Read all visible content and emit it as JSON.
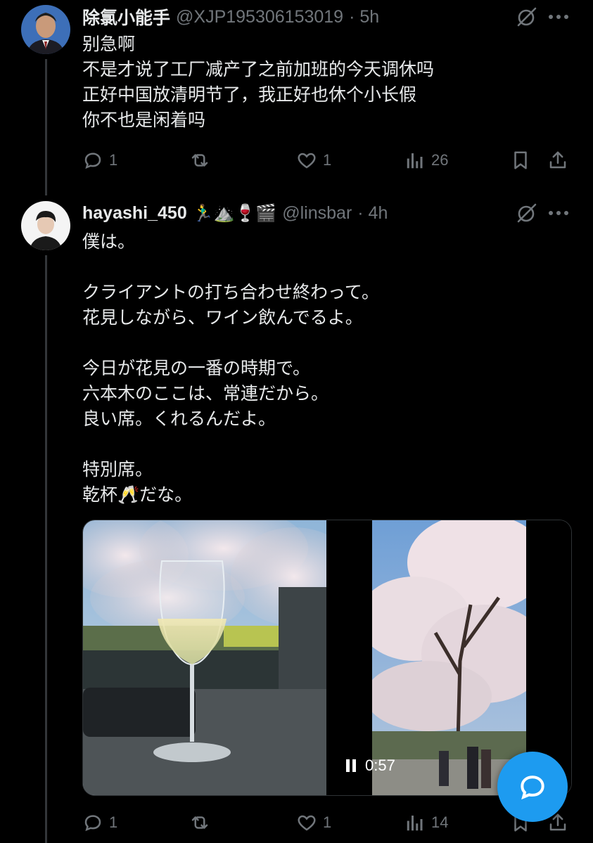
{
  "tweet1": {
    "name": "除氯小能手",
    "handle": "@XJP195306153019",
    "time": "· 5h",
    "lines": [
      "别急啊",
      "不是才说了工厂减产了之前加班的今天调休吗",
      "正好中国放清明节了，我正好也休个小长假",
      "你不也是闲着吗"
    ],
    "replies": "1",
    "retweets": "",
    "likes": "1",
    "views": "26"
  },
  "tweet2": {
    "name": "hayashi_450",
    "emojis": "🏃‍♂️⛰️🍷🎬",
    "handle": "@linsbar",
    "time": "· 4h",
    "lines": [
      "僕は。",
      "",
      "クライアントの打ち合わせ終わって。",
      "花見しながら、ワイン飲んでるよ。",
      "",
      "今日が花見の一番の時期で。",
      "六本木のここは、常連だから。",
      "良い席。くれるんだよ。",
      "",
      "特別席。",
      "乾杯🥂だな。"
    ],
    "video_time": "0:57",
    "replies": "1",
    "retweets": "",
    "likes": "1",
    "views": "14"
  },
  "icons": {
    "reply": "reply-icon",
    "retweet": "retweet-icon",
    "like": "heart-icon",
    "views": "views-icon",
    "bookmark": "bookmark-icon",
    "share": "share-icon",
    "grok": "grok-icon",
    "more": "more-icon",
    "compose": "reply-compose-icon"
  },
  "colors": {
    "background": "#000000",
    "text": "#e7e9ea",
    "muted": "#71767b",
    "accent": "#1d9bf0"
  }
}
